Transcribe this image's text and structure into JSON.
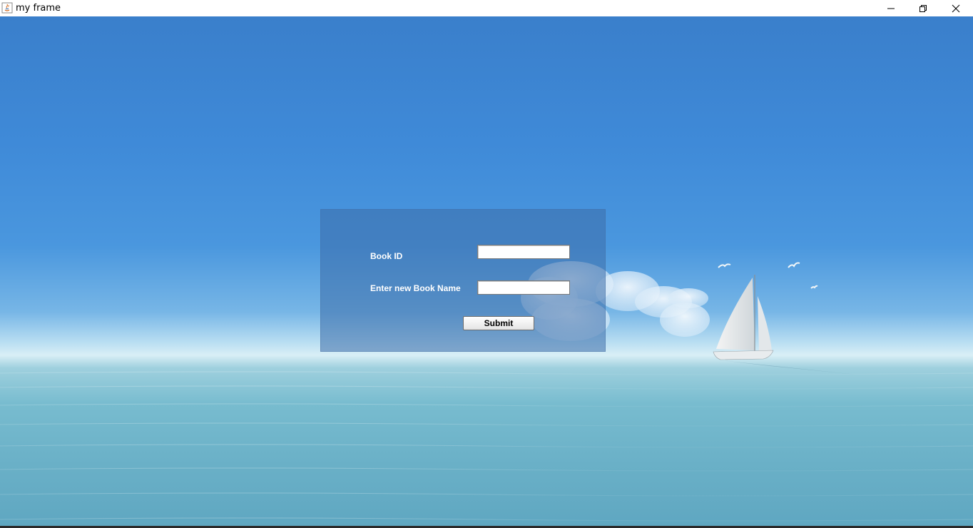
{
  "window": {
    "title": "my frame",
    "app_icon": "java-icon",
    "controls": [
      "minimize-icon",
      "restore-icon",
      "close-icon"
    ]
  },
  "background": {
    "description_icon": "sailboat-icon",
    "sky_color": "#3f8ad8",
    "sea_color": "#6ab0c7"
  },
  "form": {
    "book_id_label": "Book ID",
    "book_id_value": "",
    "book_name_label": "Enter new Book Name",
    "book_name_value": "",
    "submit_label": "Submit"
  }
}
